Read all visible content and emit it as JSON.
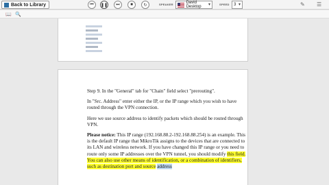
{
  "toolbar": {
    "back_label": "Back to Library",
    "speaker_label": "SPEAKER",
    "speaker_value": "David Desktop",
    "speed_label": "SPEED",
    "speed_value": "3",
    "icons": [
      "previous-icon",
      "pause-icon",
      "next-icon",
      "stop-icon",
      "refresh-icon",
      "pen-icon",
      "menu-icon"
    ]
  },
  "subbar": {
    "icons": [
      "book-icon",
      "search-icon"
    ]
  },
  "document": {
    "step": "Step 9. In the \"General\" tab for \"Chain\" field select \"prerouting\".",
    "src": "In \"Src. Address\" enter either the IP, or the IP range which you wish to have routed through the VPN connection.",
    "here": "Here we use source address to identify packets which should be routed through VPN.",
    "notice_label": "Please notice:",
    "notice_text": " This IP range (192.168.88.2-192.168.88.254) is an example. This is the default IP range that MikroTik assigns to the devices that are connected to its LAN and wireless network. If you have changed this IP range or you need to route only some IP addresses over the VPN tunnel, you should modify ",
    "highlighted_text": "this field. You can also use other means of identification, or a combination of identifiers, such as destination port and source",
    "selected_word": "address"
  }
}
